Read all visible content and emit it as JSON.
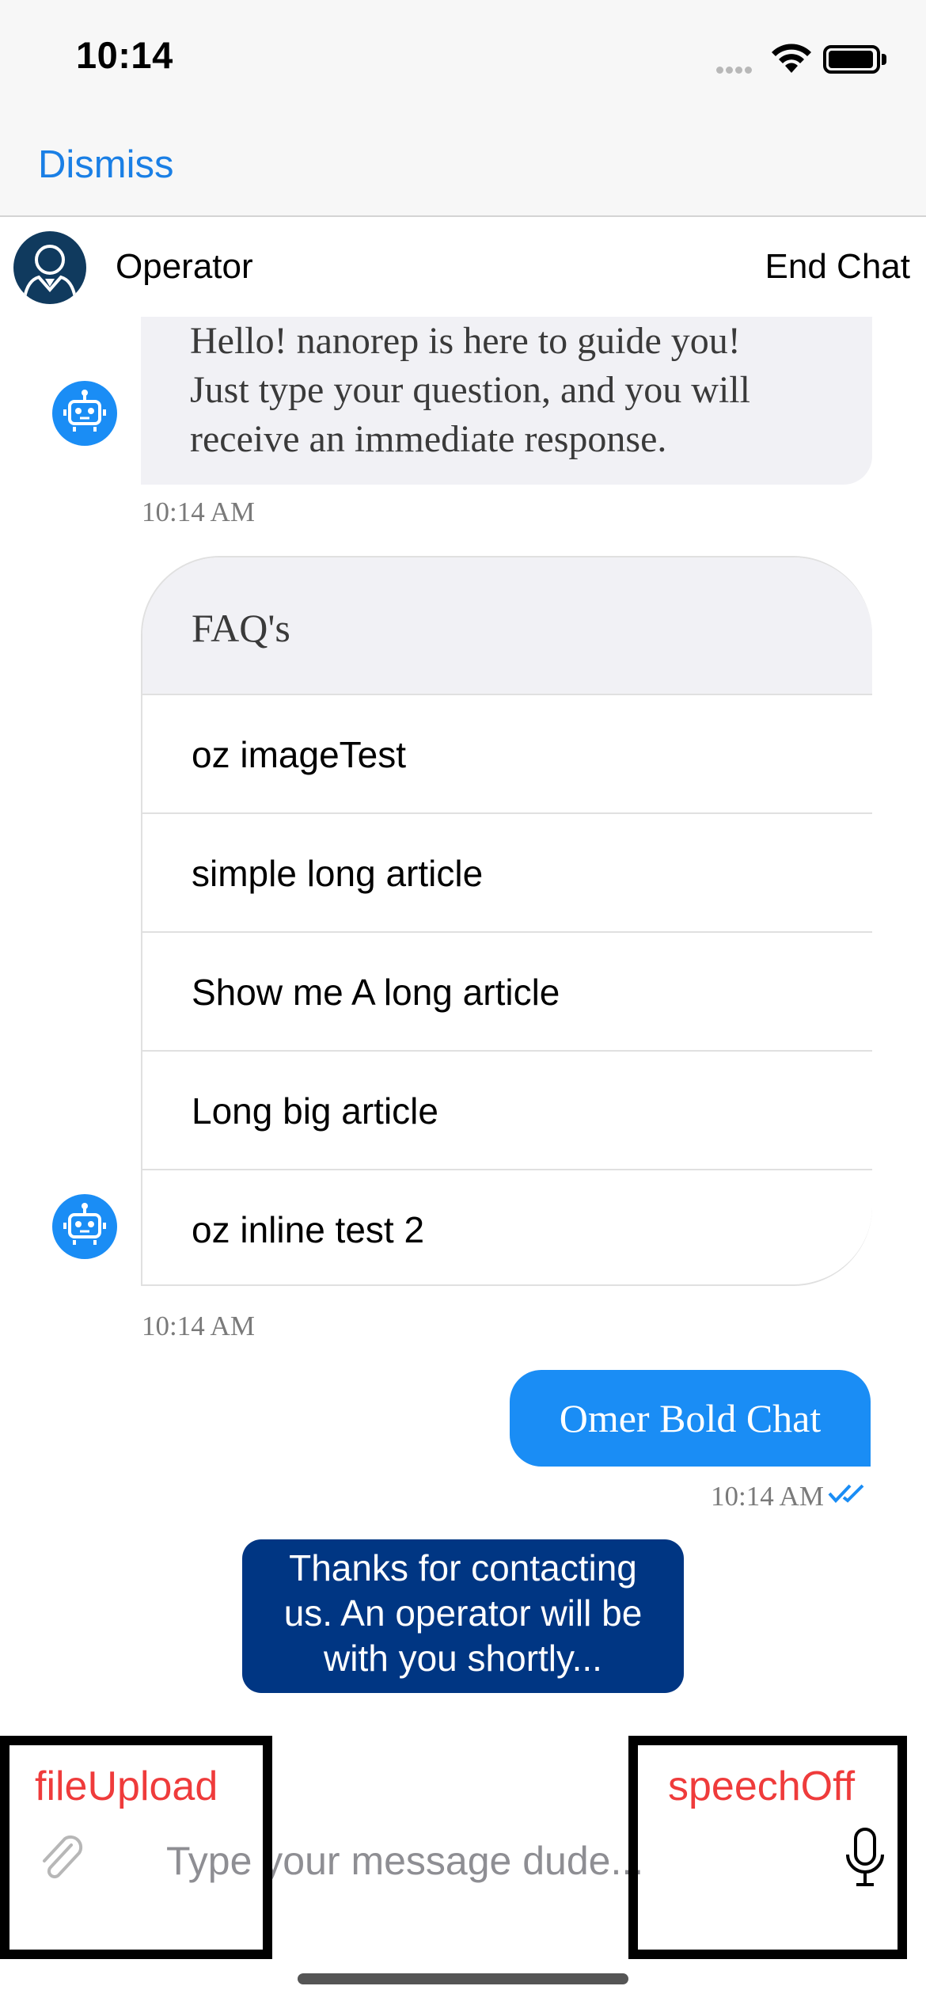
{
  "status_bar": {
    "time": "10:14"
  },
  "nav": {
    "dismiss_label": "Dismiss"
  },
  "chat_header": {
    "operator_name": "Operator",
    "end_chat_label": "End Chat"
  },
  "messages": {
    "bot_greeting": {
      "lines": [
        "Hello! nanorep is here to guide you!",
        "Just type your question, and you will",
        "receive an immediate response."
      ],
      "timestamp": "10:14 AM"
    },
    "faq": {
      "title": "FAQ's",
      "items": [
        {
          "label": "oz imageTest"
        },
        {
          "label": "simple long article"
        },
        {
          "label": "Show me A long article"
        },
        {
          "label": "Long big article"
        },
        {
          "label": "oz inline test 2"
        }
      ],
      "timestamp": "10:14 AM"
    },
    "user_message": {
      "text": "Omer Bold Chat",
      "timestamp": "10:14 AM"
    },
    "system_message": {
      "lines": [
        "Thanks for contacting",
        "us. An operator will be",
        "with you shortly..."
      ]
    }
  },
  "input": {
    "placeholder": "Type your message dude...",
    "file_upload_label": "fileUpload",
    "speech_label": "speechOff"
  },
  "icons": {
    "operator": "operator-avatar-icon",
    "bot": "robot-icon",
    "attach": "paperclip-icon",
    "mic": "microphone-icon",
    "read": "double-check-icon"
  },
  "colors": {
    "accent": "#1a8df5",
    "nav_link": "#1a7fe5",
    "system_bubble": "#003683",
    "debug_label": "#ef3b3b"
  }
}
